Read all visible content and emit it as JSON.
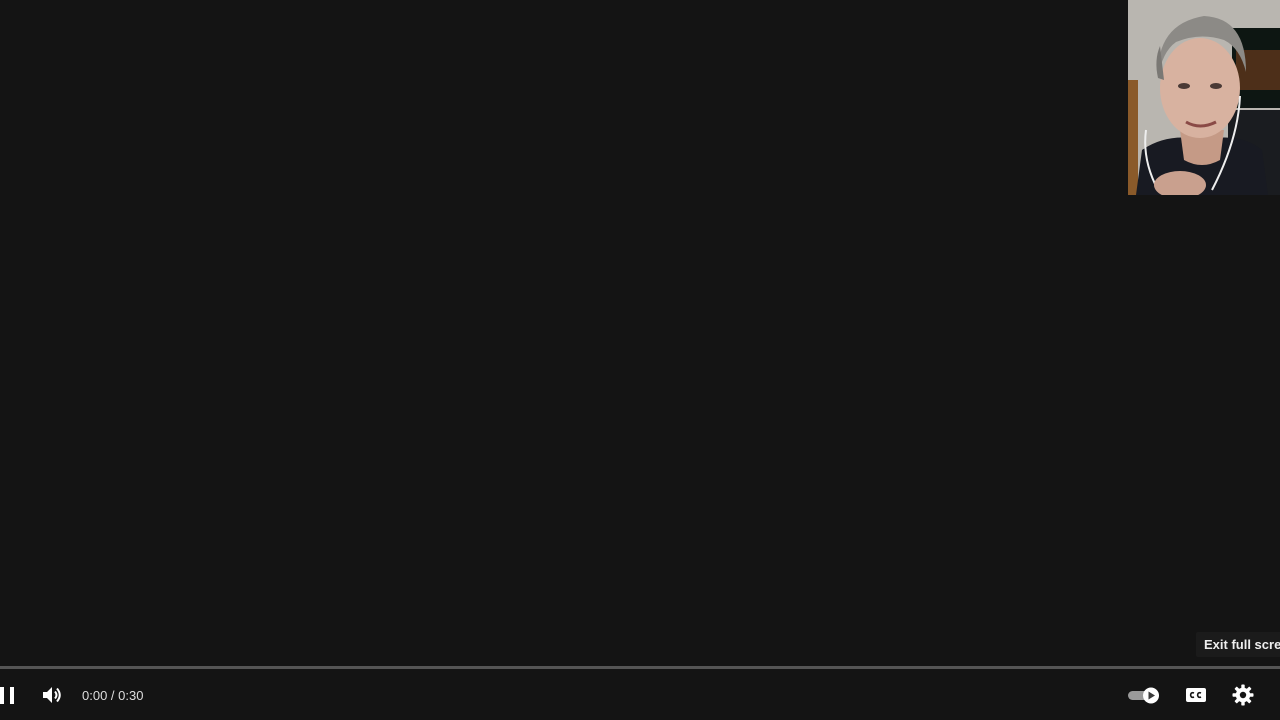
{
  "player": {
    "time": {
      "current": "0:00",
      "separator": " / ",
      "duration": "0:30"
    },
    "progress_fraction": 0.0,
    "tooltip": "Exit full scree",
    "state": "playing",
    "autoplay_on": true,
    "icons": {
      "pause": "pause-icon",
      "volume": "volume-icon",
      "autoplay": "autoplay-toggle-icon",
      "captions": "closed-captions-icon",
      "settings": "settings-gear-icon"
    },
    "colors": {
      "background": "#141414",
      "progress_played": "#ff0000",
      "controls": "#ffffff"
    }
  }
}
